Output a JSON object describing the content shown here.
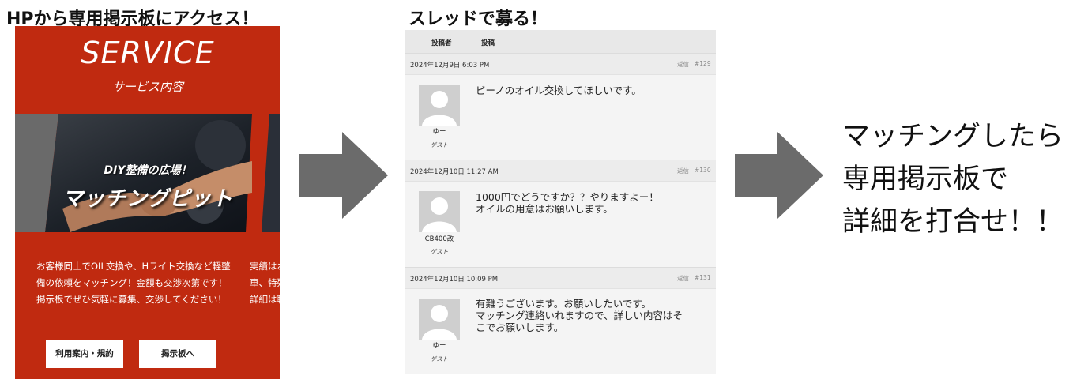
{
  "captions": {
    "left": "HPから専用掲示板にアクセス！",
    "middle": "スレッドで募る！"
  },
  "service": {
    "title": "SERVICE",
    "subtitle": "サービス内容",
    "photo_line1": "DIY整備の広場！",
    "photo_line2": "マッチングピット",
    "body1": "お客様同士でOIL交換や、Hライト交換など軽整備の依頼をマッチング！金額も交渉次第です！掲示板でぜひ気軽に募集、交渉してください！",
    "body2_lines": [
      "実績はお",
      "車、特殊",
      "詳細は職"
    ],
    "buttons": {
      "terms": "利用案内・規約",
      "board": "掲示板へ"
    },
    "colors": {
      "background": "#c02a10"
    }
  },
  "thread": {
    "header": {
      "poster": "投稿者",
      "post": "投稿"
    },
    "reply_label": "返信",
    "posts": [
      {
        "date": "2024年12月9日 6:03 PM",
        "number": "#129",
        "name": "ゆー",
        "role": "ゲスト",
        "lines": [
          "ビーノのオイル交換してほしいです。"
        ]
      },
      {
        "date": "2024年12月10日 11:27 AM",
        "number": "#130",
        "name": "CB400改",
        "role": "ゲスト",
        "lines": [
          "1000円でどうですか？？やりますよー！",
          "オイルの用意はお願いします。"
        ]
      },
      {
        "date": "2024年12月10日 10:09 PM",
        "number": "#131",
        "name": "ゆー",
        "role": "ゲスト",
        "lines": [
          "有難うございます。お願いしたいです。",
          "マッチング連絡いれますので、詳しい内容はそ",
          "こでお願いします。"
        ]
      }
    ]
  },
  "final_text": [
    "マッチングしたら",
    "専用掲示板で",
    "詳細を打合せ！！"
  ],
  "icons": {
    "arrow": "right-arrow-icon",
    "avatar": "default-user-avatar-icon"
  },
  "colors": {
    "arrow": "#6b6b6b"
  }
}
